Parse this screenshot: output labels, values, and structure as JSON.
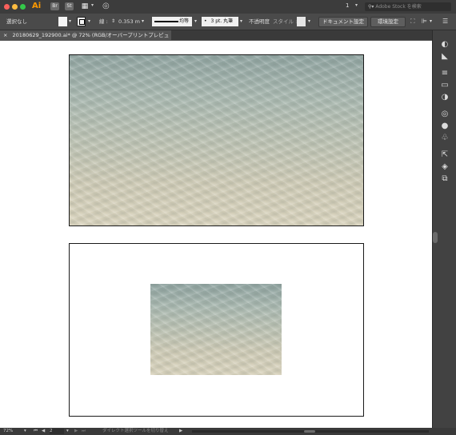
{
  "window": {
    "app_logo": "Ai",
    "traffic_lights": {
      "close": "#fc605c",
      "minimize": "#fdbc40",
      "zoom": "#34c84a"
    },
    "bridge_label": "Br",
    "stock_label": "St",
    "page_number": "1",
    "search_placeholder": "Adobe Stock を検索"
  },
  "control_bar": {
    "selection_status": "選択なし",
    "stroke_label": "線 :",
    "stroke_value": "0.353 m",
    "profile_label": "均等",
    "brush_label": "3 pt. 丸筆",
    "opacity_label": "不透明度",
    "style_label": "スタイル :",
    "document_settings_button": "ドキュメント設定",
    "preferences_button": "環境設定"
  },
  "document_tab": {
    "close_symbol": "×",
    "title": "20180629_192900.ai* @ 72% (RGB/オーバープリントプレビュー)"
  },
  "status_bar": {
    "zoom": "72%",
    "artboard_number": "2",
    "tool_name": "ダイレクト選択ツールを切り替え"
  },
  "colors": {
    "accent": "#ff9a00",
    "ui_dark": "#535353",
    "panel": "#424242"
  },
  "right_panel_icons": [
    "color-guide-icon",
    "color-icon",
    "stroke-icon",
    "gradient-icon",
    "transparency-icon",
    "appearance-icon",
    "graphic-style-icon",
    "symbols-icon",
    "export-icon",
    "layers-icon",
    "artboards-icon"
  ]
}
